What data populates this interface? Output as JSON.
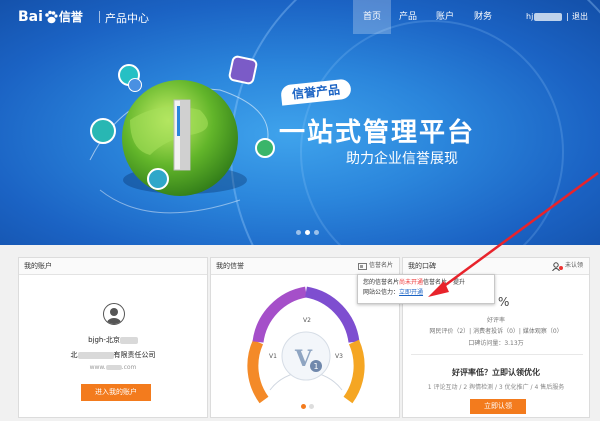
{
  "header": {
    "logo_text_left": "Bai",
    "logo_text_right": "信誉",
    "product_center": "产品中心",
    "nav": [
      "首页",
      "产品",
      "账户",
      "财务"
    ],
    "user_prefix": "hj",
    "logout": "退出",
    "separator": "|"
  },
  "hero": {
    "tag": "信誉产品",
    "headline": "一站式管理平台",
    "subline": "助力企业信誉展现",
    "slides": 3,
    "active_slide": 2
  },
  "account_panel": {
    "title": "我的账户",
    "username": "bjgh-北京",
    "company_prefix": "北",
    "company_suffix": "有限责任公司",
    "site_prefix": "www.",
    "site_suffix": ".com",
    "enter_button": "进入我的账户"
  },
  "credit_panel": {
    "title": "我的信誉",
    "card_link": "信誉名片",
    "version_labels": [
      "V1",
      "V2",
      "V3"
    ]
  },
  "reputation_panel": {
    "title": "我的口碑",
    "auth_link": "未认领",
    "tooltip_line1_a": "您的信誉名片",
    "tooltip_line1_red": "尚未开通",
    "tooltip_line1_b": "信誉名片，提升",
    "tooltip_line2_a": "网站公信力：",
    "tooltip_line2_link": "立即开通",
    "percent": "%",
    "good_rate_label": "好评率",
    "stats_line": "网民评价（2）| 消费者投诉（0）| 媒体观察（0）",
    "visits_line": "口碑访问量：3.13万",
    "optimize_title": "好评率低？立即认领优化",
    "optimize_steps": "1 评论互动 / 2 舆情检测 / 3 优化推广 / 4 售后服务",
    "claim_button": "立即认领"
  },
  "colors": {
    "accent_orange": "#f37b1d",
    "hero_blue": "#2b86dc",
    "annotation_arrow": "#e8232b"
  }
}
